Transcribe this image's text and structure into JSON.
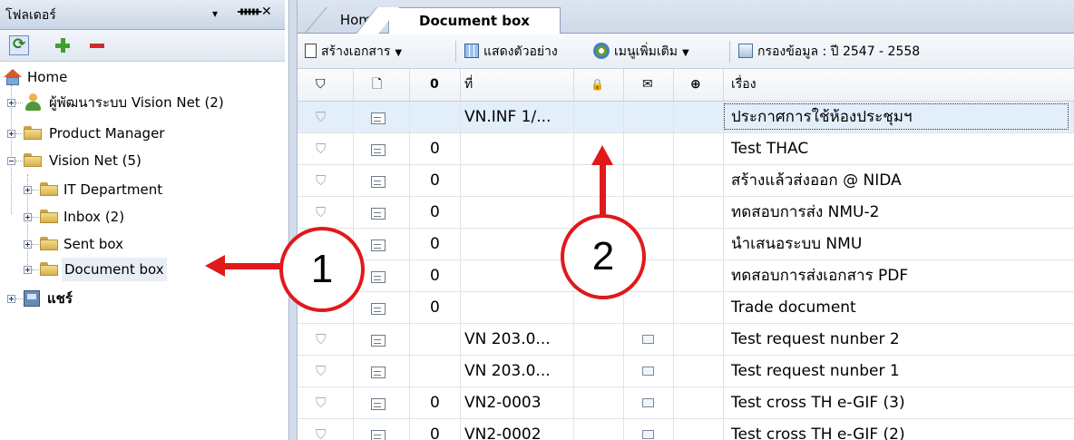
{
  "folder_panel": {
    "title": "โฟลเดอร์",
    "controls": {
      "dropdown": "▾",
      "pin": "ꟷ",
      "close": "✕"
    },
    "tree": [
      {
        "label": "Home",
        "icon": "home-icon"
      },
      {
        "label": "ผู้พัฒนาระบบ Vision Net (2)",
        "icon": "user-icon"
      },
      {
        "label": "Product Manager",
        "icon": "folder-icon"
      },
      {
        "label": "Vision Net (5)",
        "icon": "folder-icon"
      },
      {
        "label": "IT Department",
        "icon": "folder-icon"
      },
      {
        "label": "Inbox (2)",
        "icon": "inbox-folder-icon"
      },
      {
        "label": "Sent box",
        "icon": "sent-folder-icon"
      },
      {
        "label": "Document box",
        "icon": "document-folder-icon"
      },
      {
        "label": "แชร์",
        "icon": "share-icon"
      }
    ]
  },
  "tabs": [
    {
      "label": "Home"
    },
    {
      "label": "Document box",
      "active": true
    }
  ],
  "toolbar": {
    "create_label": "สร้างเอกสาร",
    "preview_label": "แสดงตัวอย่าง",
    "more_label": "เมนูเพิ่มเติม",
    "filter_label": "กรองข้อมูล : ปี 2547 - 2558"
  },
  "grid": {
    "columns": {
      "flag": "⛉",
      "type": "🗋",
      "attach": "0",
      "number": "ที่",
      "lock": "🔒",
      "mail": "✉",
      "globe": "⊕",
      "subject": "เรื่อง"
    },
    "rows": [
      {
        "number": "VN.INF 1/...",
        "subject": "ประกาศการใช้ห้องประชุมฯ",
        "attach": false,
        "mail": false,
        "selected": true
      },
      {
        "number": "",
        "subject": "Test THAC",
        "attach": true,
        "mail": false
      },
      {
        "number": "",
        "subject": "สร้างแล้วส่งออก @ NIDA",
        "attach": true,
        "mail": false
      },
      {
        "number": "",
        "subject": "ทดสอบการส่ง NMU-2",
        "attach": true,
        "mail": false
      },
      {
        "number": "",
        "subject": "นำเสนอระบบ NMU",
        "attach": true,
        "mail": false
      },
      {
        "number": "",
        "subject": "ทดสอบการส่งเอกสาร PDF",
        "attach": true,
        "mail": false
      },
      {
        "number": "",
        "subject": "Trade document",
        "attach": true,
        "mail": false
      },
      {
        "number": "VN 203.0...",
        "subject": "Test request nunber 2",
        "attach": false,
        "mail": true
      },
      {
        "number": "VN 203.0...",
        "subject": "Test request nunber 1",
        "attach": false,
        "mail": true
      },
      {
        "number": "VN2-0003",
        "subject": "Test cross TH e-GIF (3)",
        "attach": true,
        "mail": true
      },
      {
        "number": "VN2-0002",
        "subject": "Test cross TH e-GIF (2)",
        "attach": true,
        "mail": true
      }
    ]
  },
  "callouts": [
    "1",
    "2"
  ],
  "colors": {
    "callout_red": "#e0191b",
    "selected_row": "#e3eefb",
    "panel_header": "#c9d5e6"
  }
}
